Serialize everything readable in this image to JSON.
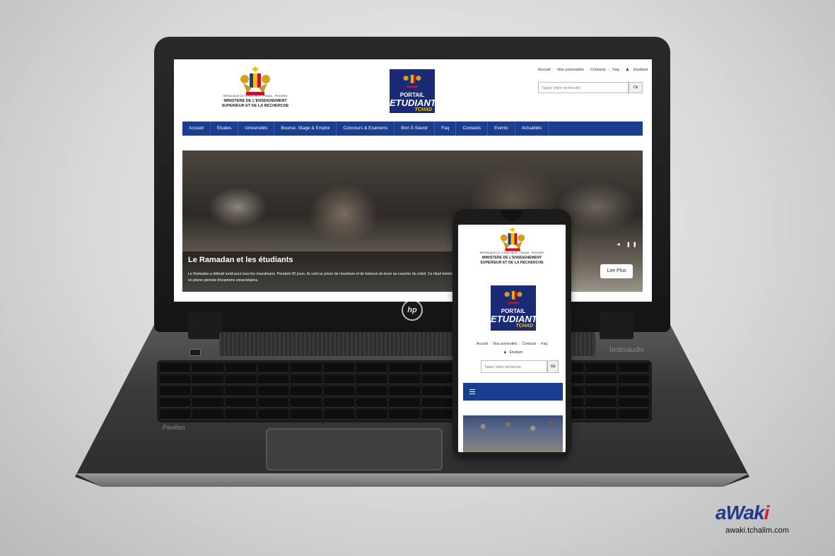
{
  "desktop_site": {
    "header": {
      "republic_text": "RÉPUBLIQUE DU TCHAD UNITÉ - TRAVAIL - PROGRÈS",
      "ministry_line1": "MINISTERE DE L'ENSEIGNEMENT",
      "ministry_line2": "SUPERIEUR ET DE LA RECHERCHE",
      "logo": {
        "line1": "PORTAIL",
        "line2": "ETUDIANT",
        "line3": "TCHAD"
      }
    },
    "top_links": [
      "Accueil",
      "Nos universités",
      "Contacts",
      "Faq",
      "Etudiant"
    ],
    "search": {
      "placeholder": "Tapez Votre recherche",
      "button": "Ok"
    },
    "nav": [
      "Accueil",
      "Etudes",
      "Universités",
      "Bourse, Stage & Emploi",
      "Concours & Examens",
      "Bon À Savoir",
      "Faq",
      "Contacts",
      "Events",
      "Actualités"
    ],
    "hero": {
      "title": "Le Ramadan et les étudiants",
      "text": "Le Ramadan a débuté lundi pour tous les musulmans. Pendant 30 jours, ils vont se priver de nourriture et de boisson du lever au coucher du soleil. Ce rituel tombe en pleine période d'examens universitaires.",
      "button": "Lire Plus",
      "controls": "◄ ❚❚ ►"
    }
  },
  "mobile_site": {
    "republic_text": "RÉPUBLIQUE DU TCHAD UNITÉ - TRAVAIL - PROGRÈS",
    "ministry_line1": "MINISTERE DE L'ENSEIGNEMENT",
    "ministry_line2": "SUPERIEUR ET DE LA RECHERCHE",
    "logo": {
      "line1": "PORTAIL",
      "line2": "ETUDIANT",
      "line3": "TCHAD"
    },
    "top_links": [
      "Accueil",
      "Nos universités",
      "Contacts",
      "Faq",
      "Etudiant"
    ],
    "search": {
      "placeholder": "Tapez Votre recherche",
      "button": "Ok"
    },
    "menu_icon": "hamburger-icon"
  },
  "device_labels": {
    "laptop_brand": "hp",
    "laptop_model": "Pavilion",
    "audio_brand": "beatsaudio"
  },
  "watermark": {
    "logo_a": "a",
    "logo_rest": "Wak",
    "logo_i": "i",
    "url": "awaki.tchalim.com"
  },
  "colors": {
    "nav_blue": "#1a3d8f",
    "logo_blue": "#1a2a75",
    "logo_yellow": "#f2c400",
    "watermark_blue": "#223a8a",
    "watermark_red": "#d1212a"
  }
}
